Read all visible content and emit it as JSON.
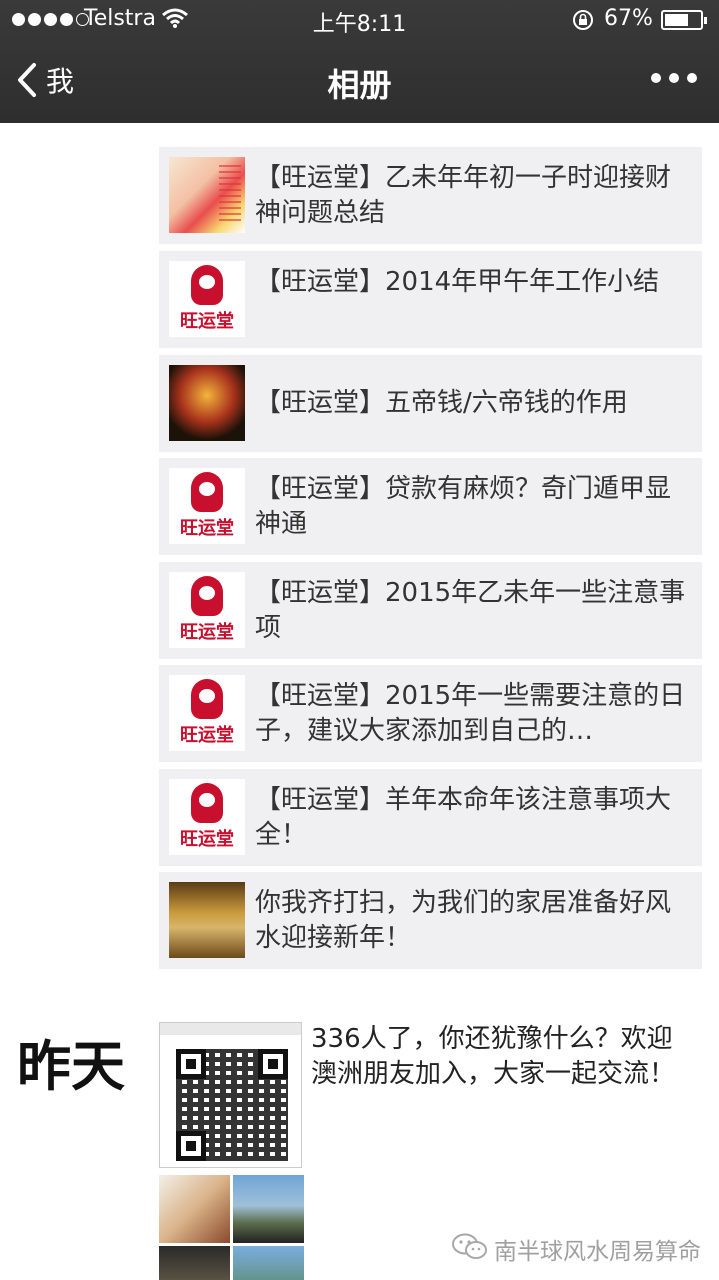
{
  "status_bar": {
    "carrier": "Telstra",
    "time": "上午8:11",
    "battery_percent": "67%",
    "battery_level": 0.67
  },
  "nav": {
    "back_label": "我",
    "title": "相册"
  },
  "articles": [
    {
      "title": "【旺运堂】乙未年年初一子时迎接财神问题总结",
      "thumb": "deity-poster"
    },
    {
      "title": "【旺运堂】2014年甲午年工作小结",
      "thumb": "wangyuntang-logo"
    },
    {
      "title": "【旺运堂】五帝钱/六帝钱的作用",
      "thumb": "coins-photo"
    },
    {
      "title": "【旺运堂】贷款有麻烦？奇门遁甲显神通",
      "thumb": "wangyuntang-logo"
    },
    {
      "title": "【旺运堂】2015年乙未年一些注意事项",
      "thumb": "wangyuntang-logo"
    },
    {
      "title": "【旺运堂】2015年一些需要注意的日子，建议大家添加到自己的…",
      "thumb": "wangyuntang-logo"
    },
    {
      "title": "【旺运堂】羊年本命年该注意事项大全！",
      "thumb": "wangyuntang-logo"
    },
    {
      "title": "你我齐打扫，为我们的家居准备好风水迎接新年！",
      "thumb": "room-photo"
    }
  ],
  "logo_text": "旺运堂",
  "yesterday": {
    "label": "昨天",
    "post_text": "336人了，你还犹豫什么？欢迎澳洲朋友加入，大家一起交流！"
  },
  "watermark": "南半球风水周易算命",
  "icons": [
    "back-chevron-icon",
    "more-dots-icon",
    "wifi-icon",
    "rotation-lock-icon",
    "wechat-icon"
  ]
}
